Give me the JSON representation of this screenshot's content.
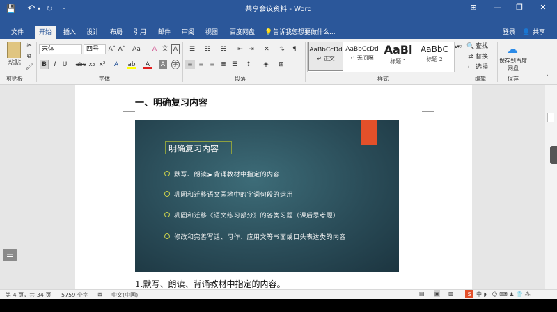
{
  "window": {
    "title": "共享会议资料 - Word",
    "controls": {
      "ribbon_display": "⊞",
      "minimize": "—",
      "restore": "❐",
      "close": "✕"
    }
  },
  "qat": {
    "save": "💾",
    "undo": "↶",
    "undo_arrow": "▾",
    "redo": "↻",
    "customize": "₌"
  },
  "tabs": [
    "文件",
    "开始",
    "插入",
    "设计",
    "布局",
    "引用",
    "邮件",
    "审阅",
    "视图",
    "百度网盘"
  ],
  "active_tab": "开始",
  "tell_me": "告诉我您想要做什么...",
  "account": {
    "login": "登录",
    "share": "共享"
  },
  "ribbon": {
    "clipboard": {
      "paste": "粘贴",
      "label": "剪贴板"
    },
    "font": {
      "name": "宋体",
      "size": "四号",
      "grow": "A˄",
      "shrink": "A˅",
      "case": "Aa",
      "clear": "A",
      "pinyin": "文",
      "border": "A",
      "bold": "B",
      "italic": "I",
      "underline": "U",
      "strike": "abc",
      "subscript": "x₂",
      "superscript": "x²",
      "label": "字体"
    },
    "paragraph": {
      "label": "段落"
    },
    "styles": {
      "items": [
        {
          "sample": "AaBbCcDd",
          "name": "↵ 正文"
        },
        {
          "sample": "AaBbCcDd",
          "name": "↵ 无间隔"
        },
        {
          "sample": "AaBl",
          "name": "标题 1"
        },
        {
          "sample": "AaBbC",
          "name": "标题 2"
        }
      ],
      "label": "样式"
    },
    "editing": {
      "find": "查找",
      "replace": "替换",
      "select": "选择",
      "label": "编辑"
    },
    "save": {
      "button": "保存到百度网盘",
      "label": "保存"
    }
  },
  "document": {
    "heading": "一、明确复习内容",
    "slide": {
      "title": "明确复习内容",
      "bullets": [
        "默写、朗读、背诵教材中指定的内容",
        "巩固和迁移语文园地中的字词句段的运用",
        "巩固和迁移《语文练习部分》的各类习题（课后思考题）",
        "修改和完善写话、习作、应用文等书面或口头表达类的内容"
      ]
    },
    "line1": "1.默写、朗读、背诵教材中指定的内容。"
  },
  "status": {
    "page": "第 4 页，共 34 页",
    "words": "5759 个字",
    "language": "中文(中国)"
  },
  "colors": {
    "word_blue": "#2b579a",
    "slide_accent": "#e3502a",
    "bullet": "#c9d04d"
  }
}
